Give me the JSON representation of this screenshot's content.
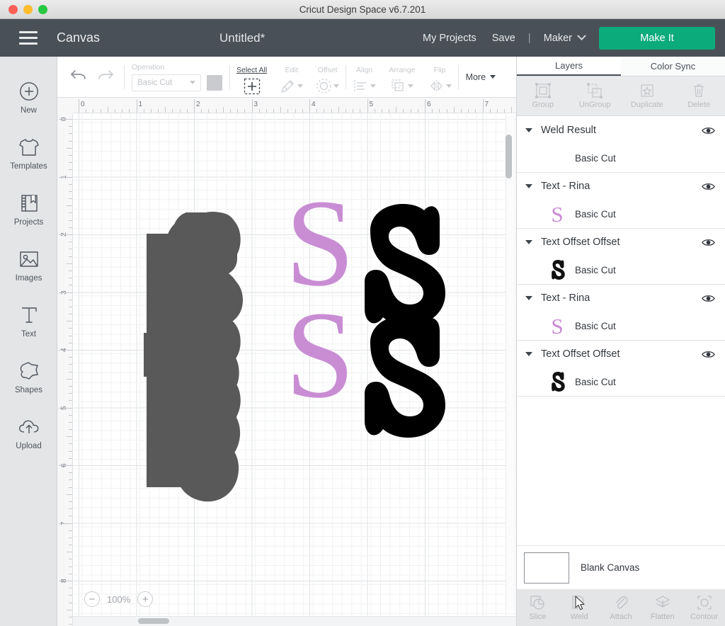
{
  "window": {
    "title": "Cricut Design Space  v6.7.201",
    "traffic_lights": [
      "close-red",
      "minimize-yellow",
      "maximize-green"
    ]
  },
  "header": {
    "menu_icon": "hamburger-icon",
    "canvas_label": "Canvas",
    "document_title": "Untitled*",
    "my_projects": "My Projects",
    "save": "Save",
    "separator": "|",
    "machine": "Maker",
    "machine_chevron": "chevron-down-icon",
    "make_it": "Make It",
    "make_it_color": "#0cab7c",
    "background_color": "#4a5058"
  },
  "sidebar": {
    "items": [
      {
        "label": "New",
        "icon": "plus-circle-icon"
      },
      {
        "label": "Templates",
        "icon": "tshirt-icon"
      },
      {
        "label": "Projects",
        "icon": "book-bookmark-icon"
      },
      {
        "label": "Images",
        "icon": "picture-icon"
      },
      {
        "label": "Text",
        "icon": "text-t-icon"
      },
      {
        "label": "Shapes",
        "icon": "star-blob-icon"
      },
      {
        "label": "Upload",
        "icon": "cloud-upload-icon"
      }
    ]
  },
  "toolbar": {
    "undo": "undo-arrow-icon",
    "redo": "redo-arrow-icon",
    "operation_caption": "Operation",
    "operation_value": "Basic Cut",
    "operation_swatch_color": "#c9cbce",
    "select_all": "Select All",
    "edit": "Edit",
    "offset": "Offset",
    "align": "Align",
    "arrange": "Arrange",
    "flip": "Flip",
    "more": "More",
    "disabled_color": "#c6c9cd",
    "enabled_color": "#3f454c"
  },
  "canvas": {
    "ruler_h_ticks": [
      "0",
      "1",
      "2",
      "3",
      "4",
      "5",
      "6",
      "7"
    ],
    "ruler_v_ticks": [
      "0",
      "1",
      "2",
      "3",
      "4",
      "5",
      "6",
      "7",
      "8"
    ],
    "zoom_value": "100%",
    "zoom_out": "−",
    "zoom_in": "+",
    "shapes": [
      {
        "name": "weld-result-blob",
        "color": "#595959"
      },
      {
        "name": "letter-s-top",
        "color": "#c98dd4"
      },
      {
        "name": "letter-s-bottom",
        "color": "#c98dd4"
      },
      {
        "name": "offset-s-top",
        "color": "#000000"
      },
      {
        "name": "offset-s-bottom",
        "color": "#000000"
      }
    ]
  },
  "panel": {
    "tabs": [
      {
        "label": "Layers",
        "selected": true
      },
      {
        "label": "Color Sync",
        "selected": false
      }
    ],
    "actions": [
      {
        "label": "Group",
        "icon": "group-icon",
        "disabled": true
      },
      {
        "label": "UnGroup",
        "icon": "ungroup-icon",
        "disabled": true
      },
      {
        "label": "Duplicate",
        "icon": "duplicate-icon",
        "disabled": true
      },
      {
        "label": "Delete",
        "icon": "trash-icon",
        "disabled": true
      }
    ],
    "layers": [
      {
        "title": "Weld Result",
        "visibility_icon": "eye-icon",
        "expand_icon": "triangle-down-icon",
        "rows": [
          {
            "label": "Basic Cut",
            "thumb": "none"
          }
        ]
      },
      {
        "title": "Text - Rina",
        "visibility_icon": "eye-icon",
        "expand_icon": "triangle-down-icon",
        "rows": [
          {
            "label": "Basic Cut",
            "thumb": "letter-s-pink",
            "thumb_color": "#c98dd4"
          }
        ]
      },
      {
        "title": "Text Offset Offset",
        "visibility_icon": "eye-icon",
        "expand_icon": "triangle-down-icon",
        "rows": [
          {
            "label": "Basic Cut",
            "thumb": "offset-s-black",
            "thumb_color": "#111111"
          }
        ]
      },
      {
        "title": "Text - Rina",
        "visibility_icon": "eye-icon",
        "expand_icon": "triangle-down-icon",
        "rows": [
          {
            "label": "Basic Cut",
            "thumb": "letter-s-pink",
            "thumb_color": "#c98dd4"
          }
        ]
      },
      {
        "title": "Text Offset Offset",
        "visibility_icon": "eye-icon",
        "expand_icon": "triangle-down-icon",
        "rows": [
          {
            "label": "Basic Cut",
            "thumb": "offset-s-black",
            "thumb_color": "#111111"
          }
        ]
      }
    ],
    "blank_canvas": {
      "label": "Blank Canvas",
      "swatch_color": "#ffffff"
    },
    "bottom_tools": [
      {
        "label": "Slice",
        "icon": "slice-icon"
      },
      {
        "label": "Weld",
        "icon": "weld-icon"
      },
      {
        "label": "Attach",
        "icon": "paperclip-icon"
      },
      {
        "label": "Flatten",
        "icon": "flatten-icon"
      },
      {
        "label": "Contour",
        "icon": "contour-icon"
      }
    ]
  }
}
